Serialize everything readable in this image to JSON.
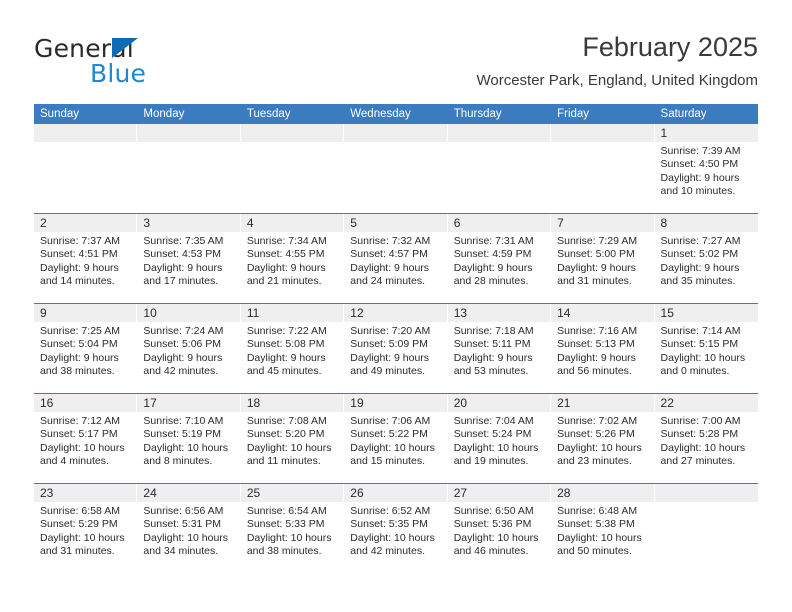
{
  "brand": {
    "name_primary": "General",
    "name_secondary": "Blue",
    "triangle_color": "#0d6cb3",
    "secondary_color": "#1b8ad4"
  },
  "header": {
    "title": "February 2025",
    "subtitle": "Worcester Park, England, United Kingdom"
  },
  "theme": {
    "header_blue": "#3b7cc0",
    "daynum_strip": "#efefef",
    "text": "#2b2b2b"
  },
  "weekdays": [
    "Sunday",
    "Monday",
    "Tuesday",
    "Wednesday",
    "Thursday",
    "Friday",
    "Saturday"
  ],
  "weeks": [
    [
      {
        "day": "",
        "sunrise": "",
        "sunset": "",
        "daylight1": "",
        "daylight2": ""
      },
      {
        "day": "",
        "sunrise": "",
        "sunset": "",
        "daylight1": "",
        "daylight2": ""
      },
      {
        "day": "",
        "sunrise": "",
        "sunset": "",
        "daylight1": "",
        "daylight2": ""
      },
      {
        "day": "",
        "sunrise": "",
        "sunset": "",
        "daylight1": "",
        "daylight2": ""
      },
      {
        "day": "",
        "sunrise": "",
        "sunset": "",
        "daylight1": "",
        "daylight2": ""
      },
      {
        "day": "",
        "sunrise": "",
        "sunset": "",
        "daylight1": "",
        "daylight2": ""
      },
      {
        "day": "1",
        "sunrise": "Sunrise: 7:39 AM",
        "sunset": "Sunset: 4:50 PM",
        "daylight1": "Daylight: 9 hours",
        "daylight2": "and 10 minutes."
      }
    ],
    [
      {
        "day": "2",
        "sunrise": "Sunrise: 7:37 AM",
        "sunset": "Sunset: 4:51 PM",
        "daylight1": "Daylight: 9 hours",
        "daylight2": "and 14 minutes."
      },
      {
        "day": "3",
        "sunrise": "Sunrise: 7:35 AM",
        "sunset": "Sunset: 4:53 PM",
        "daylight1": "Daylight: 9 hours",
        "daylight2": "and 17 minutes."
      },
      {
        "day": "4",
        "sunrise": "Sunrise: 7:34 AM",
        "sunset": "Sunset: 4:55 PM",
        "daylight1": "Daylight: 9 hours",
        "daylight2": "and 21 minutes."
      },
      {
        "day": "5",
        "sunrise": "Sunrise: 7:32 AM",
        "sunset": "Sunset: 4:57 PM",
        "daylight1": "Daylight: 9 hours",
        "daylight2": "and 24 minutes."
      },
      {
        "day": "6",
        "sunrise": "Sunrise: 7:31 AM",
        "sunset": "Sunset: 4:59 PM",
        "daylight1": "Daylight: 9 hours",
        "daylight2": "and 28 minutes."
      },
      {
        "day": "7",
        "sunrise": "Sunrise: 7:29 AM",
        "sunset": "Sunset: 5:00 PM",
        "daylight1": "Daylight: 9 hours",
        "daylight2": "and 31 minutes."
      },
      {
        "day": "8",
        "sunrise": "Sunrise: 7:27 AM",
        "sunset": "Sunset: 5:02 PM",
        "daylight1": "Daylight: 9 hours",
        "daylight2": "and 35 minutes."
      }
    ],
    [
      {
        "day": "9",
        "sunrise": "Sunrise: 7:25 AM",
        "sunset": "Sunset: 5:04 PM",
        "daylight1": "Daylight: 9 hours",
        "daylight2": "and 38 minutes."
      },
      {
        "day": "10",
        "sunrise": "Sunrise: 7:24 AM",
        "sunset": "Sunset: 5:06 PM",
        "daylight1": "Daylight: 9 hours",
        "daylight2": "and 42 minutes."
      },
      {
        "day": "11",
        "sunrise": "Sunrise: 7:22 AM",
        "sunset": "Sunset: 5:08 PM",
        "daylight1": "Daylight: 9 hours",
        "daylight2": "and 45 minutes."
      },
      {
        "day": "12",
        "sunrise": "Sunrise: 7:20 AM",
        "sunset": "Sunset: 5:09 PM",
        "daylight1": "Daylight: 9 hours",
        "daylight2": "and 49 minutes."
      },
      {
        "day": "13",
        "sunrise": "Sunrise: 7:18 AM",
        "sunset": "Sunset: 5:11 PM",
        "daylight1": "Daylight: 9 hours",
        "daylight2": "and 53 minutes."
      },
      {
        "day": "14",
        "sunrise": "Sunrise: 7:16 AM",
        "sunset": "Sunset: 5:13 PM",
        "daylight1": "Daylight: 9 hours",
        "daylight2": "and 56 minutes."
      },
      {
        "day": "15",
        "sunrise": "Sunrise: 7:14 AM",
        "sunset": "Sunset: 5:15 PM",
        "daylight1": "Daylight: 10 hours",
        "daylight2": "and 0 minutes."
      }
    ],
    [
      {
        "day": "16",
        "sunrise": "Sunrise: 7:12 AM",
        "sunset": "Sunset: 5:17 PM",
        "daylight1": "Daylight: 10 hours",
        "daylight2": "and 4 minutes."
      },
      {
        "day": "17",
        "sunrise": "Sunrise: 7:10 AM",
        "sunset": "Sunset: 5:19 PM",
        "daylight1": "Daylight: 10 hours",
        "daylight2": "and 8 minutes."
      },
      {
        "day": "18",
        "sunrise": "Sunrise: 7:08 AM",
        "sunset": "Sunset: 5:20 PM",
        "daylight1": "Daylight: 10 hours",
        "daylight2": "and 11 minutes."
      },
      {
        "day": "19",
        "sunrise": "Sunrise: 7:06 AM",
        "sunset": "Sunset: 5:22 PM",
        "daylight1": "Daylight: 10 hours",
        "daylight2": "and 15 minutes."
      },
      {
        "day": "20",
        "sunrise": "Sunrise: 7:04 AM",
        "sunset": "Sunset: 5:24 PM",
        "daylight1": "Daylight: 10 hours",
        "daylight2": "and 19 minutes."
      },
      {
        "day": "21",
        "sunrise": "Sunrise: 7:02 AM",
        "sunset": "Sunset: 5:26 PM",
        "daylight1": "Daylight: 10 hours",
        "daylight2": "and 23 minutes."
      },
      {
        "day": "22",
        "sunrise": "Sunrise: 7:00 AM",
        "sunset": "Sunset: 5:28 PM",
        "daylight1": "Daylight: 10 hours",
        "daylight2": "and 27 minutes."
      }
    ],
    [
      {
        "day": "23",
        "sunrise": "Sunrise: 6:58 AM",
        "sunset": "Sunset: 5:29 PM",
        "daylight1": "Daylight: 10 hours",
        "daylight2": "and 31 minutes."
      },
      {
        "day": "24",
        "sunrise": "Sunrise: 6:56 AM",
        "sunset": "Sunset: 5:31 PM",
        "daylight1": "Daylight: 10 hours",
        "daylight2": "and 34 minutes."
      },
      {
        "day": "25",
        "sunrise": "Sunrise: 6:54 AM",
        "sunset": "Sunset: 5:33 PM",
        "daylight1": "Daylight: 10 hours",
        "daylight2": "and 38 minutes."
      },
      {
        "day": "26",
        "sunrise": "Sunrise: 6:52 AM",
        "sunset": "Sunset: 5:35 PM",
        "daylight1": "Daylight: 10 hours",
        "daylight2": "and 42 minutes."
      },
      {
        "day": "27",
        "sunrise": "Sunrise: 6:50 AM",
        "sunset": "Sunset: 5:36 PM",
        "daylight1": "Daylight: 10 hours",
        "daylight2": "and 46 minutes."
      },
      {
        "day": "28",
        "sunrise": "Sunrise: 6:48 AM",
        "sunset": "Sunset: 5:38 PM",
        "daylight1": "Daylight: 10 hours",
        "daylight2": "and 50 minutes."
      },
      {
        "day": "",
        "sunrise": "",
        "sunset": "",
        "daylight1": "",
        "daylight2": ""
      }
    ]
  ]
}
